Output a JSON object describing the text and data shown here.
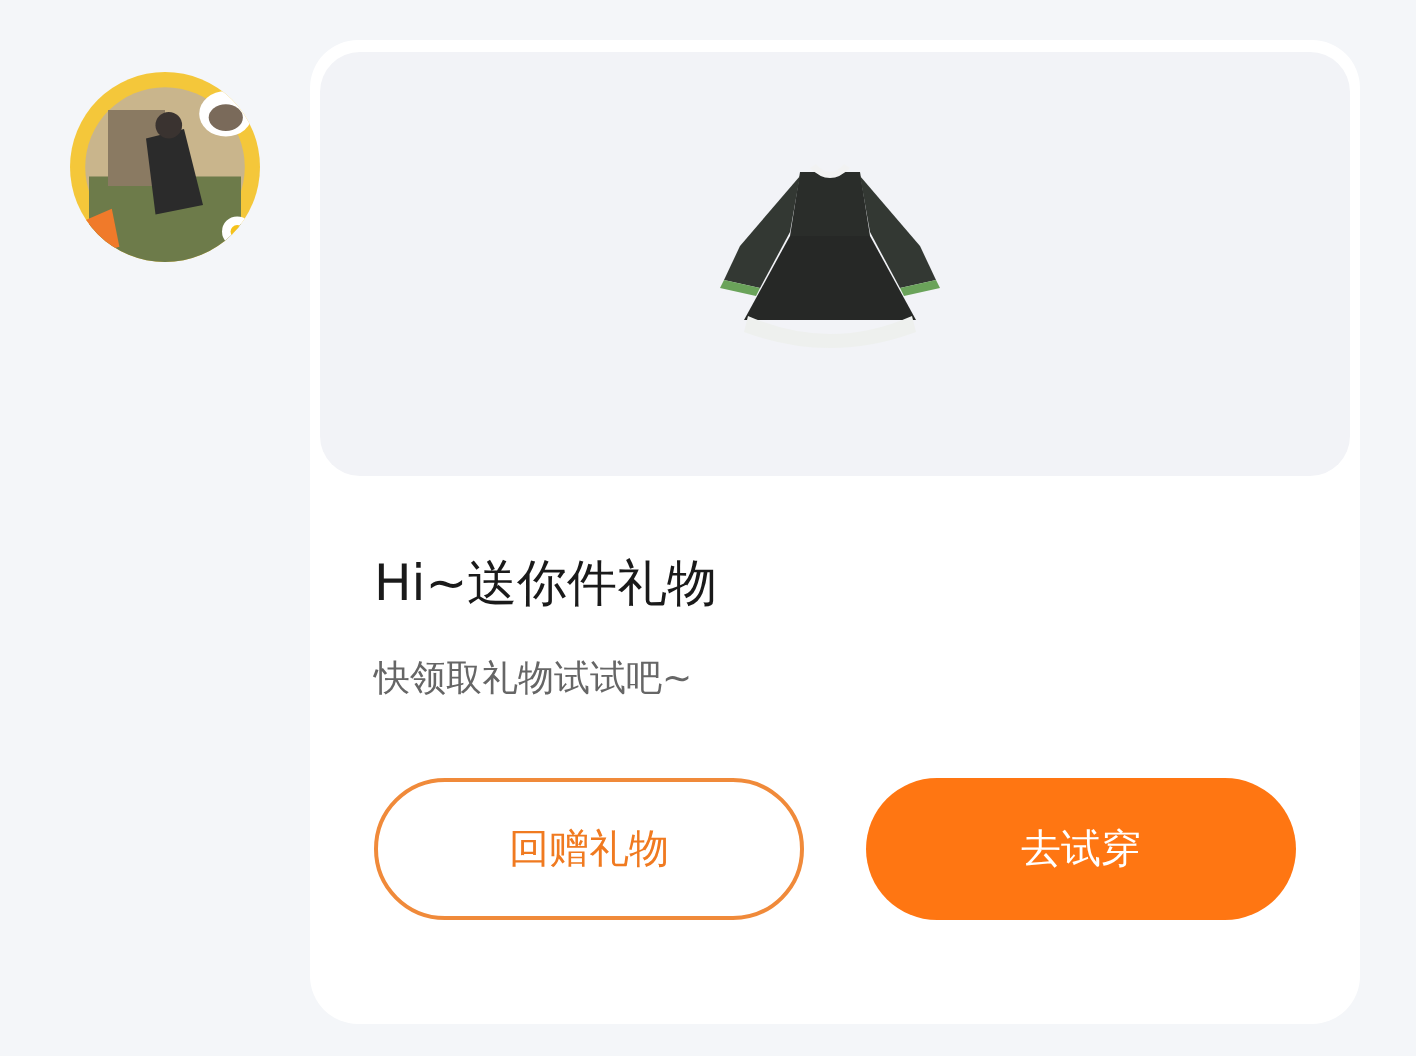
{
  "card": {
    "title": "Hi~送你件礼物",
    "subtitle": "快领取礼物试试吧~",
    "buttons": [
      {
        "label": "回赠礼物",
        "kind": "outline"
      },
      {
        "label": "去试穿",
        "kind": "filled"
      }
    ]
  }
}
